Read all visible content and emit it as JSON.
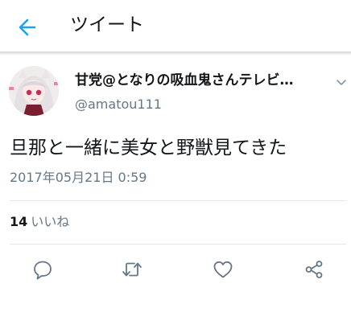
{
  "header": {
    "title": "ツイート",
    "back_icon": "arrow-left-icon",
    "accent_color": "#1da1f2"
  },
  "tweet": {
    "author_name": "甘党@となりの吸血鬼さんテレビ…",
    "author_handle": "@amatou111",
    "text": "旦那と一緒に美女と野獣見てきた",
    "timestamp": "2017年05月21日 0:59",
    "likes_count": "14",
    "likes_label": "いいね"
  },
  "actions": [
    "reply-icon",
    "retweet-icon",
    "like-icon",
    "share-icon"
  ]
}
